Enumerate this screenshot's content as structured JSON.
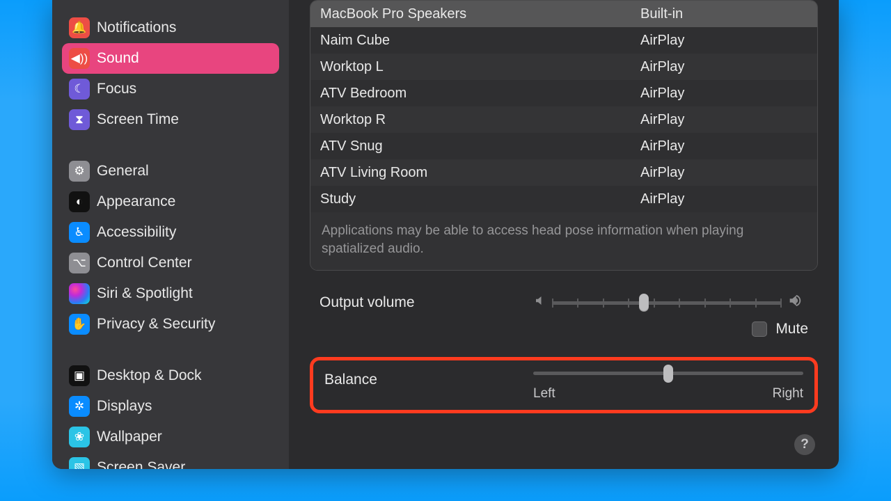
{
  "sidebar": {
    "groups": [
      [
        {
          "id": "notifications",
          "label": "Notifications",
          "iconClass": "ic-notif",
          "glyph": "🔔"
        },
        {
          "id": "sound",
          "label": "Sound",
          "iconClass": "ic-sound",
          "glyph": "◀︎))",
          "active": true
        },
        {
          "id": "focus",
          "label": "Focus",
          "iconClass": "ic-focus",
          "glyph": "☾"
        },
        {
          "id": "screentime",
          "label": "Screen Time",
          "iconClass": "ic-screentime",
          "glyph": "⧗"
        }
      ],
      [
        {
          "id": "general",
          "label": "General",
          "iconClass": "ic-general",
          "glyph": "⚙"
        },
        {
          "id": "appearance",
          "label": "Appearance",
          "iconClass": "ic-appearance",
          "glyph": "◐"
        },
        {
          "id": "accessibility",
          "label": "Accessibility",
          "iconClass": "ic-accessibility",
          "glyph": "♿︎"
        },
        {
          "id": "controlcenter",
          "label": "Control Center",
          "iconClass": "ic-controlcenter",
          "glyph": "⌥"
        },
        {
          "id": "siri",
          "label": "Siri & Spotlight",
          "iconClass": "ic-siri",
          "glyph": ""
        },
        {
          "id": "privacy",
          "label": "Privacy & Security",
          "iconClass": "ic-privacy",
          "glyph": "✋"
        }
      ],
      [
        {
          "id": "desktop",
          "label": "Desktop & Dock",
          "iconClass": "ic-desktop",
          "glyph": "▣"
        },
        {
          "id": "displays",
          "label": "Displays",
          "iconClass": "ic-displays",
          "glyph": "✲"
        },
        {
          "id": "wallpaper",
          "label": "Wallpaper",
          "iconClass": "ic-wallpaper",
          "glyph": "❀"
        },
        {
          "id": "screensaver",
          "label": "Screen Saver",
          "iconClass": "ic-screensaver",
          "glyph": "▧"
        }
      ]
    ]
  },
  "devices": [
    {
      "name": "MacBook Pro Speakers",
      "type": "Built-in",
      "selected": true
    },
    {
      "name": "Naim Cube",
      "type": "AirPlay"
    },
    {
      "name": "Worktop L",
      "type": "AirPlay"
    },
    {
      "name": "ATV Bedroom",
      "type": "AirPlay"
    },
    {
      "name": "Worktop R",
      "type": "AirPlay"
    },
    {
      "name": "ATV Snug",
      "type": "AirPlay"
    },
    {
      "name": "ATV Living Room",
      "type": "AirPlay"
    },
    {
      "name": "Study",
      "type": "AirPlay"
    }
  ],
  "note": "Applications may be able to access head pose information when playing spatialized audio.",
  "output": {
    "label": "Output volume",
    "volume_percent": 40,
    "mute_label": "Mute",
    "mute_checked": false
  },
  "balance": {
    "label": "Balance",
    "left_label": "Left",
    "right_label": "Right",
    "percent": 50
  },
  "help_glyph": "?"
}
